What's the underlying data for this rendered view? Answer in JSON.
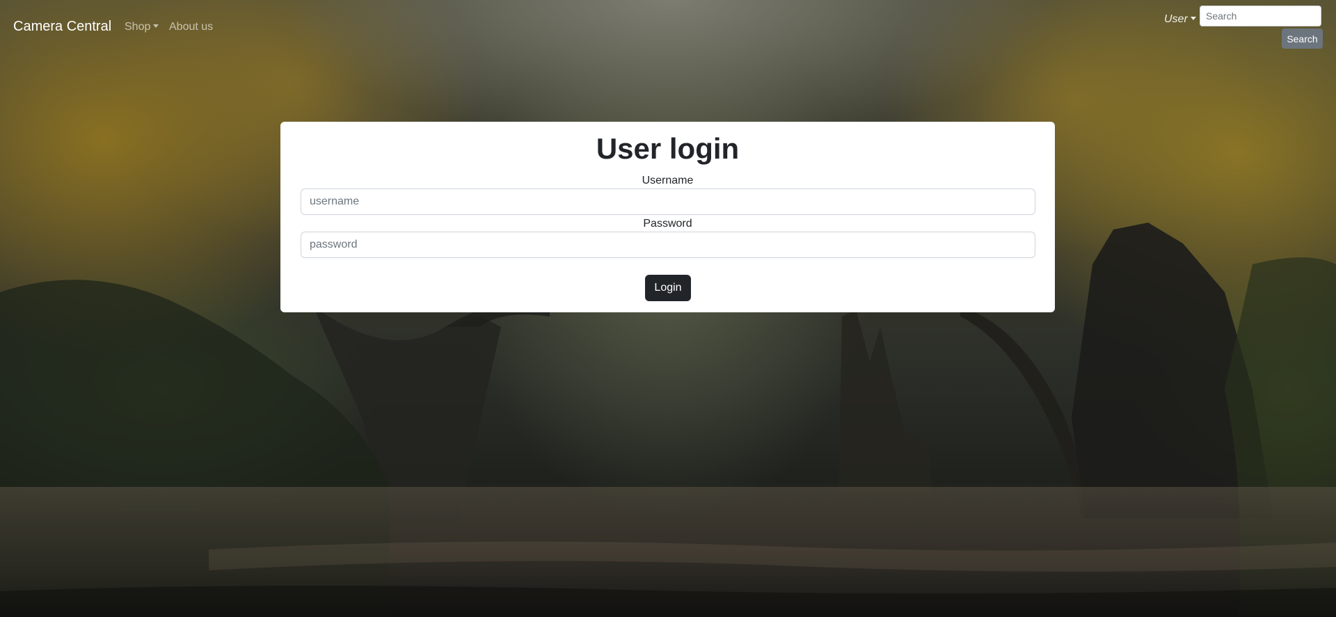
{
  "navbar": {
    "brand": "Camera Central",
    "shop_label": "Shop",
    "about_label": "About us",
    "user_label": "User",
    "search_placeholder": "Search",
    "search_value": "",
    "search_button_label": "Search"
  },
  "login": {
    "title": "User login",
    "username_label": "Username",
    "username_placeholder": "username",
    "username_value": "",
    "password_label": "Password",
    "password_placeholder": "password",
    "password_value": "",
    "submit_label": "Login"
  },
  "background": {
    "description_icon": "forest-bridge-background-image"
  }
}
